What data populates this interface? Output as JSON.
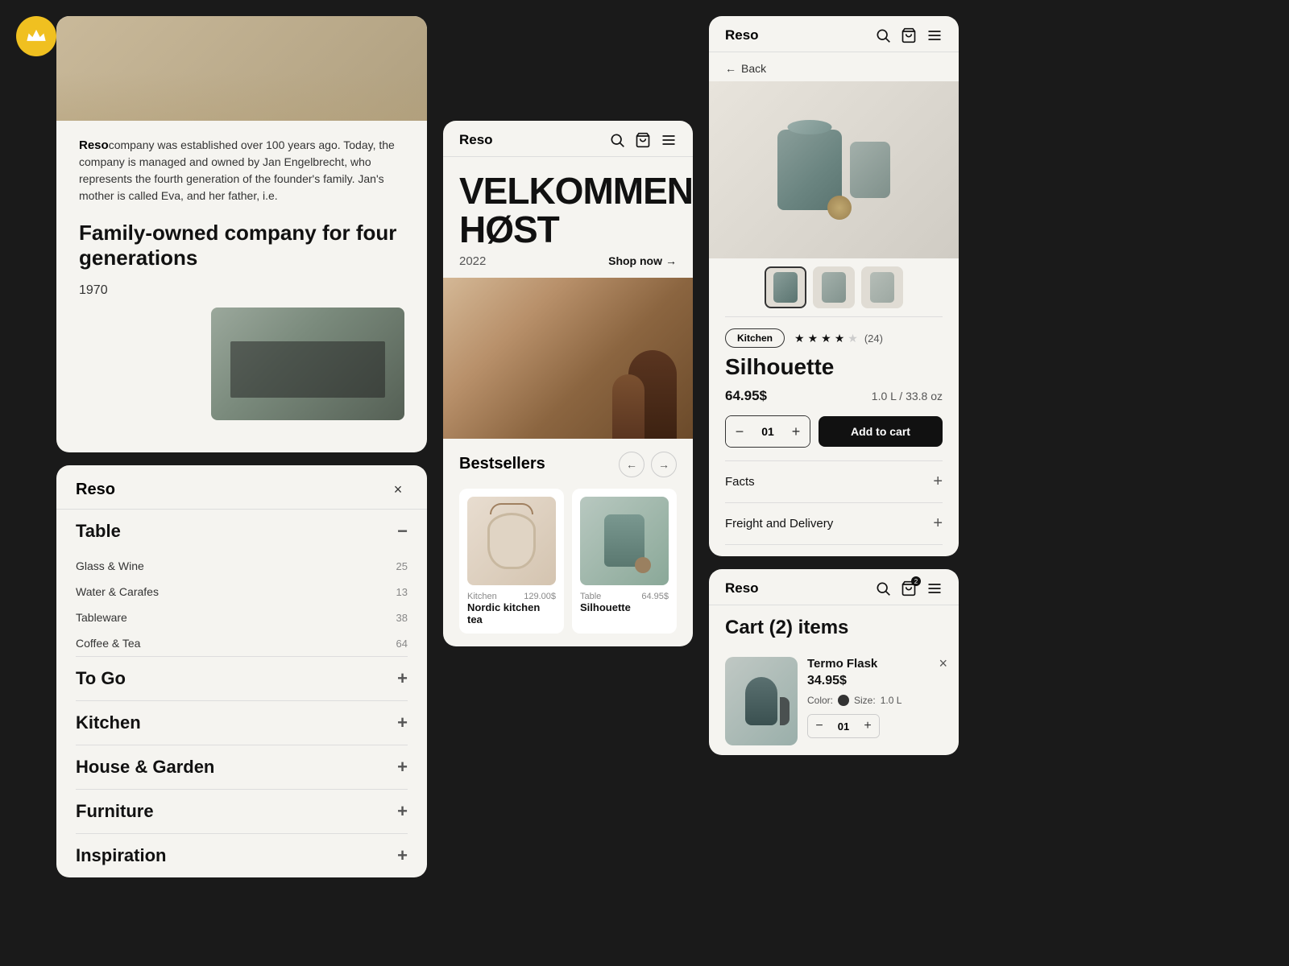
{
  "brand": "Reso",
  "logo": "crown",
  "about": {
    "brand_name": "Reso",
    "description": "company was established over 100 years ago. Today, the company is managed and owned by Jan Engelbrecht, who represents the fourth generation of the founder's family. Jan's mother is called Eva, and her father, i.e.",
    "heading": "Family-owned company for four generations",
    "year": "1970"
  },
  "nav": {
    "title": "Reso",
    "close_label": "×",
    "sections": [
      {
        "label": "Table",
        "expanded": true,
        "sub_items": [
          {
            "label": "Glass & Wine",
            "count": "25"
          },
          {
            "label": "Water & Carafes",
            "count": "13"
          },
          {
            "label": "Tableware",
            "count": "38"
          },
          {
            "label": "Coffee & Tea",
            "count": "64"
          }
        ]
      },
      {
        "label": "To Go",
        "expanded": false
      },
      {
        "label": "Kitchen",
        "expanded": false
      },
      {
        "label": "House & Garden",
        "expanded": false
      },
      {
        "label": "Furniture",
        "expanded": false
      },
      {
        "label": "Inspiration",
        "expanded": false
      }
    ]
  },
  "shop": {
    "brand": "Reso",
    "hero_title": "VELKOMMEN HØST",
    "hero_year": "2022",
    "shop_now": "Shop now",
    "bestsellers_title": "Bestsellers",
    "products": [
      {
        "category": "Kitchen",
        "price": "129.00$",
        "name": "Nordic kitchen tea",
        "image_type": "bucket"
      },
      {
        "category": "Table",
        "price": "64.95$",
        "name": "Silhouette",
        "image_type": "flask"
      }
    ]
  },
  "product_detail": {
    "brand": "Reso",
    "back_label": "Back",
    "category": "Kitchen",
    "rating": 4,
    "max_rating": 5,
    "review_count": "(24)",
    "name": "Silhouette",
    "price": "64.95$",
    "volume": "1.0 L / 33.8 oz",
    "quantity": "01",
    "add_to_cart": "Add to cart",
    "facts_label": "Facts",
    "freight_label": "Freight and Delivery"
  },
  "cart": {
    "brand": "Reso",
    "title": "Cart (2) items",
    "item": {
      "name": "Termo Flask",
      "price": "34.95$",
      "color_label": "Color:",
      "size_label": "Size:",
      "size_value": "1.0 L",
      "quantity": "01"
    }
  }
}
